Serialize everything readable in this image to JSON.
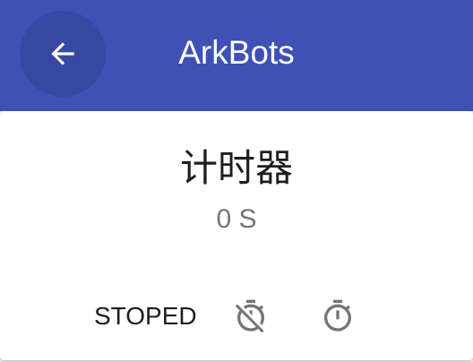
{
  "appbar": {
    "title": "ArkBots",
    "color": "#3f51b5",
    "back_icon": "arrow-back-icon"
  },
  "timer": {
    "title": "计时器",
    "value": "0 S",
    "status": "STOPED",
    "stop_icon": "timer-off-icon",
    "start_icon": "timer-icon"
  }
}
